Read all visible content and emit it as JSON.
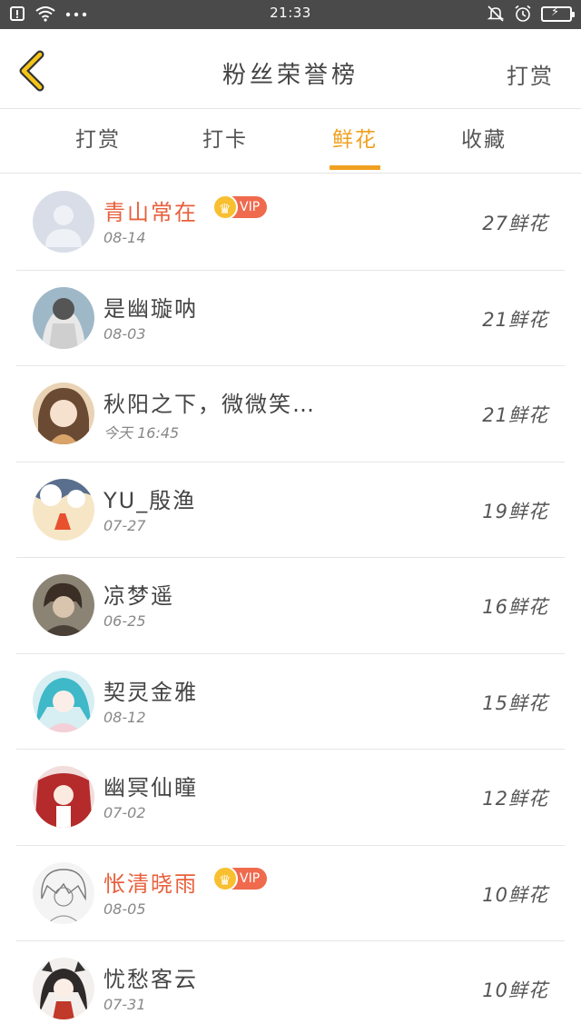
{
  "status_bar": {
    "time": "21:33",
    "left_icons": [
      "notification-icon",
      "wifi-icon",
      "more-dots-icon"
    ],
    "right_icons": [
      "mute-bell-icon",
      "alarm-icon",
      "battery-charging-icon"
    ]
  },
  "header": {
    "title": "粉丝荣誉榜",
    "action_label": "打赏"
  },
  "tabs": [
    {
      "label": "打赏",
      "active": false
    },
    {
      "label": "打卡",
      "active": false
    },
    {
      "label": "鲜花",
      "active": true
    },
    {
      "label": "收藏",
      "active": false
    }
  ],
  "accent_color": "#f0a020",
  "vip_label": "VIP",
  "rows": [
    {
      "name": "青山常在",
      "vip": true,
      "date": "08-14",
      "count": "27鲜花"
    },
    {
      "name": "是幽璇呐",
      "vip": false,
      "date": "08-03",
      "count": "21鲜花"
    },
    {
      "name": "秋阳之下，微微笑…",
      "vip": false,
      "date": "今天 16:45",
      "count": "21鲜花"
    },
    {
      "name": "YU_殷渔",
      "vip": false,
      "date": "07-27",
      "count": "19鲜花"
    },
    {
      "name": "凉梦遥",
      "vip": false,
      "date": "06-25",
      "count": "16鲜花"
    },
    {
      "name": "契灵金雅",
      "vip": false,
      "date": "08-12",
      "count": "15鲜花"
    },
    {
      "name": "幽冥仙瞳",
      "vip": false,
      "date": "07-02",
      "count": "12鲜花"
    },
    {
      "name": "怅清晓雨",
      "vip": true,
      "date": "08-05",
      "count": "10鲜花"
    },
    {
      "name": "忧愁客云",
      "vip": false,
      "date": "07-31",
      "count": "10鲜花"
    }
  ]
}
